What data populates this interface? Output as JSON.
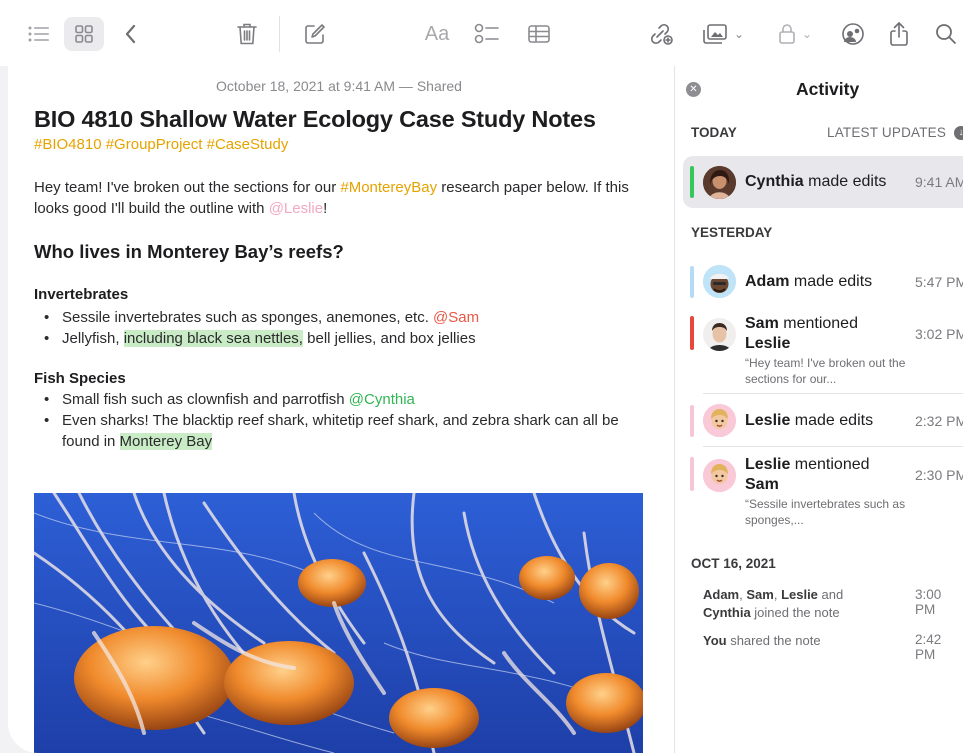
{
  "toolbar": {
    "icons": [
      "list-view-icon",
      "gallery-view-icon",
      "back-icon",
      "trash-icon",
      "compose-icon",
      "format-icon",
      "checklist-icon",
      "table-icon",
      "share-link-icon",
      "attachment-icon",
      "lock-icon",
      "collaborate-icon",
      "share-icon",
      "search-icon"
    ],
    "format_label": "Aa"
  },
  "note": {
    "date": "October 18, 2021 at 9:41 AM — Shared",
    "title": "BIO 4810 Shallow Water Ecology Case Study Notes",
    "hashtags": "#BIO4810 #GroupProject #CaseStudy",
    "intro": {
      "part1": "Hey team! I've broken out the sections for our ",
      "tag": "#MontereyBay",
      "part2": " research paper below. If this looks good I'll build the outline with ",
      "mention": "@Leslie",
      "part3": "!"
    },
    "heading": "Who lives in Monterey Bay’s reefs?",
    "sections": [
      {
        "title": "Invertebrates",
        "items": [
          {
            "text": "Sessile invertebrates such as sponges, anemones, etc. ",
            "mention": "@Sam"
          },
          {
            "text": "Jellyfish, ",
            "highlight": "including black sea nettles,",
            "rest": " bell jellies, and box jellies"
          }
        ]
      },
      {
        "title": "Fish Species",
        "items": [
          {
            "text": "Small fish such as clownfish and parrotfish ",
            "mention": "@Cynthia"
          },
          {
            "text": "Even sharks! The blacktip reef shark, whitetip reef shark, and zebra shark can all be found in ",
            "highlight": "Monterey Bay"
          }
        ]
      }
    ]
  },
  "activity": {
    "title": "Activity",
    "today_label": "TODAY",
    "latest_updates": "LATEST UPDATES",
    "yesterday_label": "YESTERDAY",
    "oct_label": "OCT 16, 2021",
    "items": [
      {
        "name": "Cynthia",
        "action": " made edits",
        "time": "9:41 AM",
        "bar_color": "#34c759"
      },
      {
        "name": "Adam",
        "action": " made edits",
        "time": "5:47 PM",
        "bar_color": "#b4dcf7"
      },
      {
        "name": "Sam",
        "action": " mentioned",
        "target": "Leslie",
        "quote": "“Hey team! I've broken out the sections for our...",
        "time": "3:02 PM",
        "bar_color": "#e8473b"
      },
      {
        "name": "Leslie",
        "action": " made edits",
        "time": "2:32 PM",
        "bar_color": "#f7c6d6"
      },
      {
        "name": "Leslie",
        "action": " mentioned",
        "target": "Sam",
        "quote": "“Sessile invertebrates such as sponges,...",
        "time": "2:30 PM",
        "bar_color": "#f7c6d6"
      }
    ],
    "older": [
      {
        "names1": "Adam",
        "sep1": ", ",
        "names2": "Sam",
        "sep2": ", ",
        "names3": "Leslie",
        "mid": " and",
        "names4": "Cynthia",
        "action": " joined the note",
        "time": "3:00 PM"
      },
      {
        "who": "You",
        "action": " shared the note",
        "time": "2:42 PM"
      }
    ]
  },
  "colors": {
    "accent": "#e6a300",
    "mention_red": "#ea5846",
    "mention_green": "#32b554",
    "mention_pink": "#f4a8c4",
    "highlight": "#c9ecc6"
  }
}
